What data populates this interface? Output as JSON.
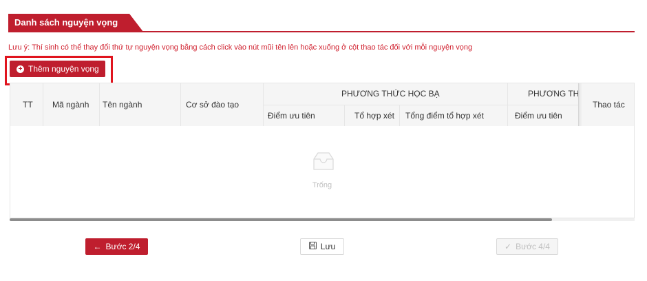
{
  "section": {
    "title": "Danh sách nguyện vọng"
  },
  "note": "Lưu ý: Thí sinh có thể thay đổi thứ tự nguyện vọng bằng cách click vào nút mũi tên lên hoặc xuống ở cột thao tác đối với mỗi nguyện vọng",
  "add_button": {
    "label": "Thêm nguyện vọng",
    "icon": "plus-circle-icon"
  },
  "table": {
    "columns": {
      "tt": "TT",
      "ma_nganh": "Mã ngành",
      "ten_nganh": "Tên ngành",
      "co_so": "Cơ sở đào tạo",
      "group1": "PHƯƠNG THỨC HỌC BẠ",
      "group1_sub": [
        "Điểm ưu tiên",
        "Tổ hợp xét",
        "Tổng điểm tổ hợp xét"
      ],
      "group2": "PHƯƠNG THỨ",
      "group2_sub": [
        "Điểm ưu tiên"
      ],
      "thao_tac": "Thao tác"
    },
    "empty_text": "Trống",
    "empty_icon": "inbox-icon"
  },
  "footer": {
    "prev_label": "Bước 2/4",
    "save_label": "Lưu",
    "next_label": "Bước 4/4"
  },
  "colors": {
    "brand": "#bf1e2e",
    "highlight": "#e0141e"
  }
}
